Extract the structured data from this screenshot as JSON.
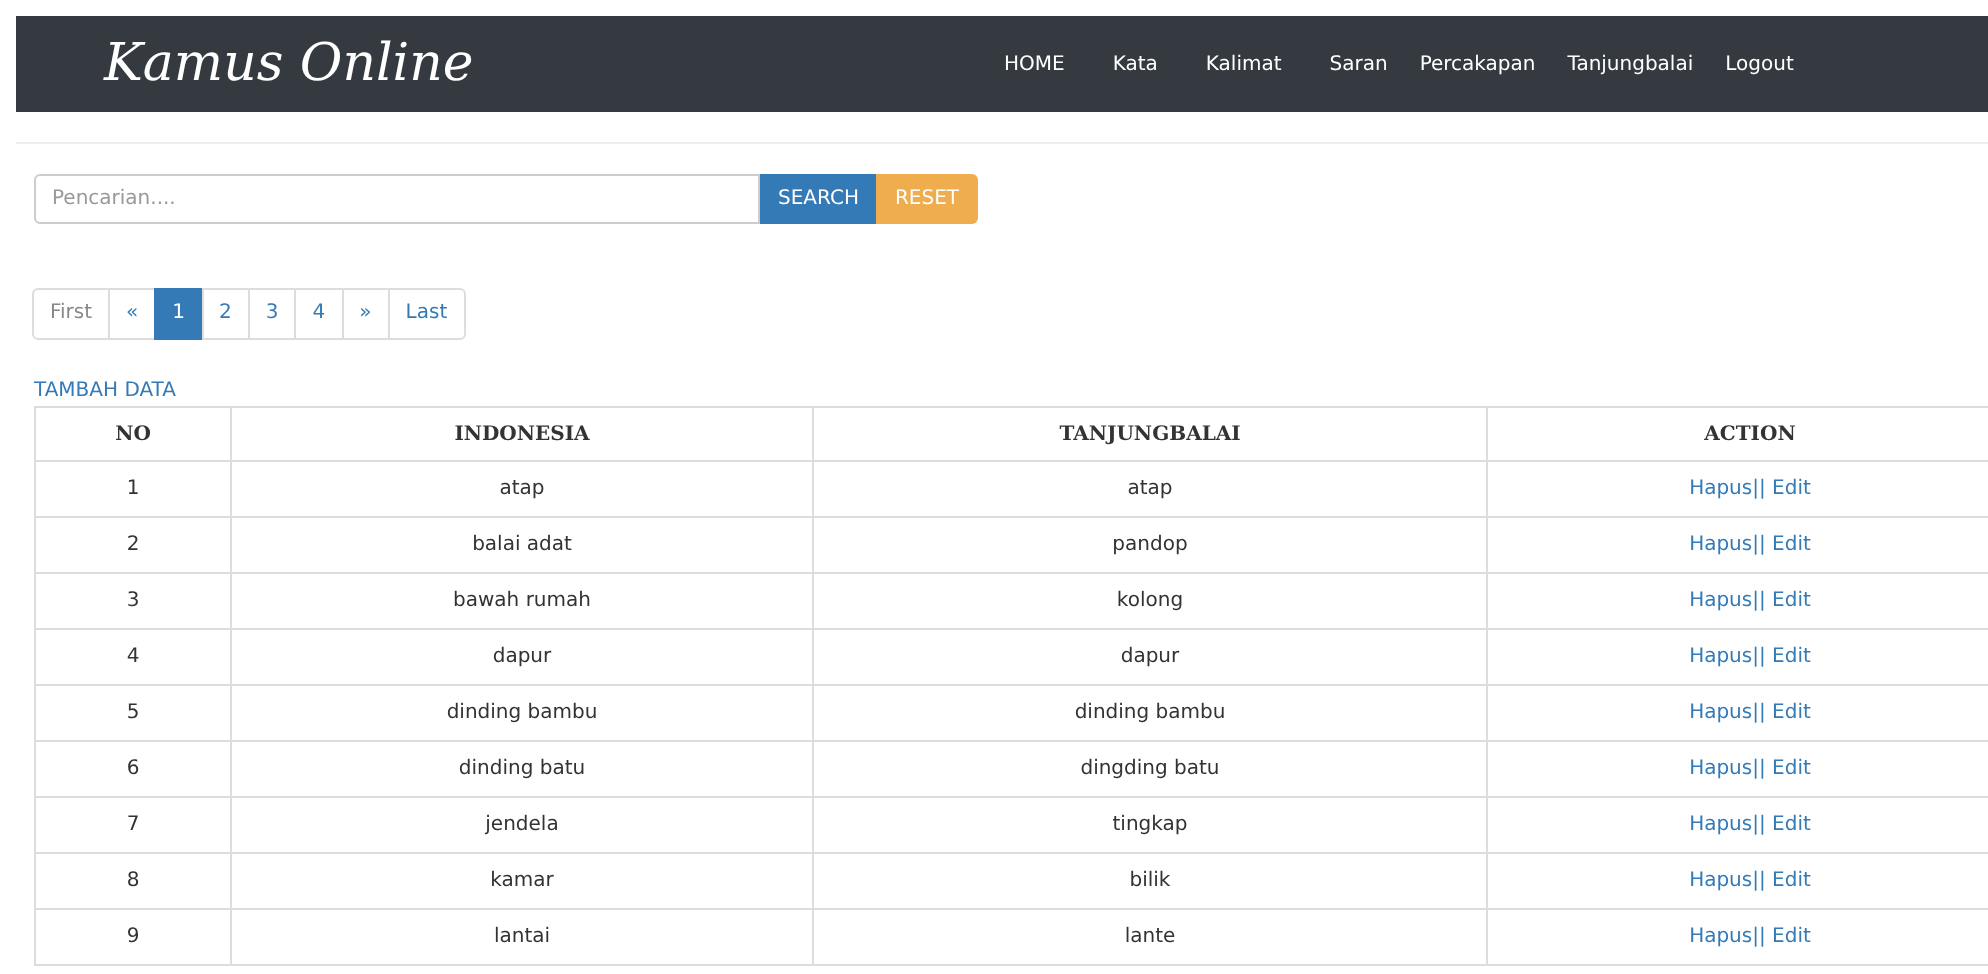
{
  "navbar": {
    "brand": "Kamus Online",
    "items": [
      "HOME",
      "Kata",
      "Kalimat",
      "Saran",
      "Percakapan",
      "Tanjungbalai",
      "Logout"
    ]
  },
  "search": {
    "placeholder": "Pencarian....",
    "search_button": "SEARCH",
    "reset_button": "RESET"
  },
  "pagination": [
    {
      "label": "First",
      "selected": false
    },
    {
      "label": "«",
      "selected": false
    },
    {
      "label": "1",
      "selected": true
    },
    {
      "label": "2",
      "selected": false
    },
    {
      "label": "3",
      "selected": false
    },
    {
      "label": "4",
      "selected": false
    },
    {
      "label": "»",
      "selected": false
    },
    {
      "label": "Last",
      "selected": false
    }
  ],
  "add_link": "TAMBAH DATA",
  "table": {
    "columns": [
      "NO",
      "INDONESIA",
      "TANJUNGBALAI",
      "ACTION"
    ],
    "rows": [
      {
        "no": "1",
        "indonesia": "atap",
        "tanjungbalai": "atap",
        "delete": "Hapus",
        "separator": "||",
        "edit": "Edit"
      },
      {
        "no": "2",
        "indonesia": "balai adat",
        "tanjungbalai": "pandop",
        "delete": "Hapus",
        "separator": "||",
        "edit": "Edit"
      },
      {
        "no": "3",
        "indonesia": "bawah rumah",
        "tanjungbalai": "kolong",
        "delete": "Hapus",
        "separator": "||",
        "edit": "Edit"
      },
      {
        "no": "4",
        "indonesia": "dapur",
        "tanjungbalai": "dapur",
        "delete": "Hapus",
        "separator": "||",
        "edit": "Edit"
      },
      {
        "no": "5",
        "indonesia": "dinding bambu",
        "tanjungbalai": "dinding bambu",
        "delete": "Hapus",
        "separator": "||",
        "edit": "Edit"
      },
      {
        "no": "6",
        "indonesia": "dinding batu",
        "tanjungbalai": "dingding batu",
        "delete": "Hapus",
        "separator": "||",
        "edit": "Edit"
      },
      {
        "no": "7",
        "indonesia": "jendela",
        "tanjungbalai": "tingkap",
        "delete": "Hapus",
        "separator": "||",
        "edit": "Edit"
      },
      {
        "no": "8",
        "indonesia": "kamar",
        "tanjungbalai": "bilik",
        "delete": "Hapus",
        "separator": "||",
        "edit": "Edit"
      },
      {
        "no": "9",
        "indonesia": "lantai",
        "tanjungbalai": "lante",
        "delete": "Hapus",
        "separator": "||",
        "edit": "Edit"
      }
    ]
  }
}
